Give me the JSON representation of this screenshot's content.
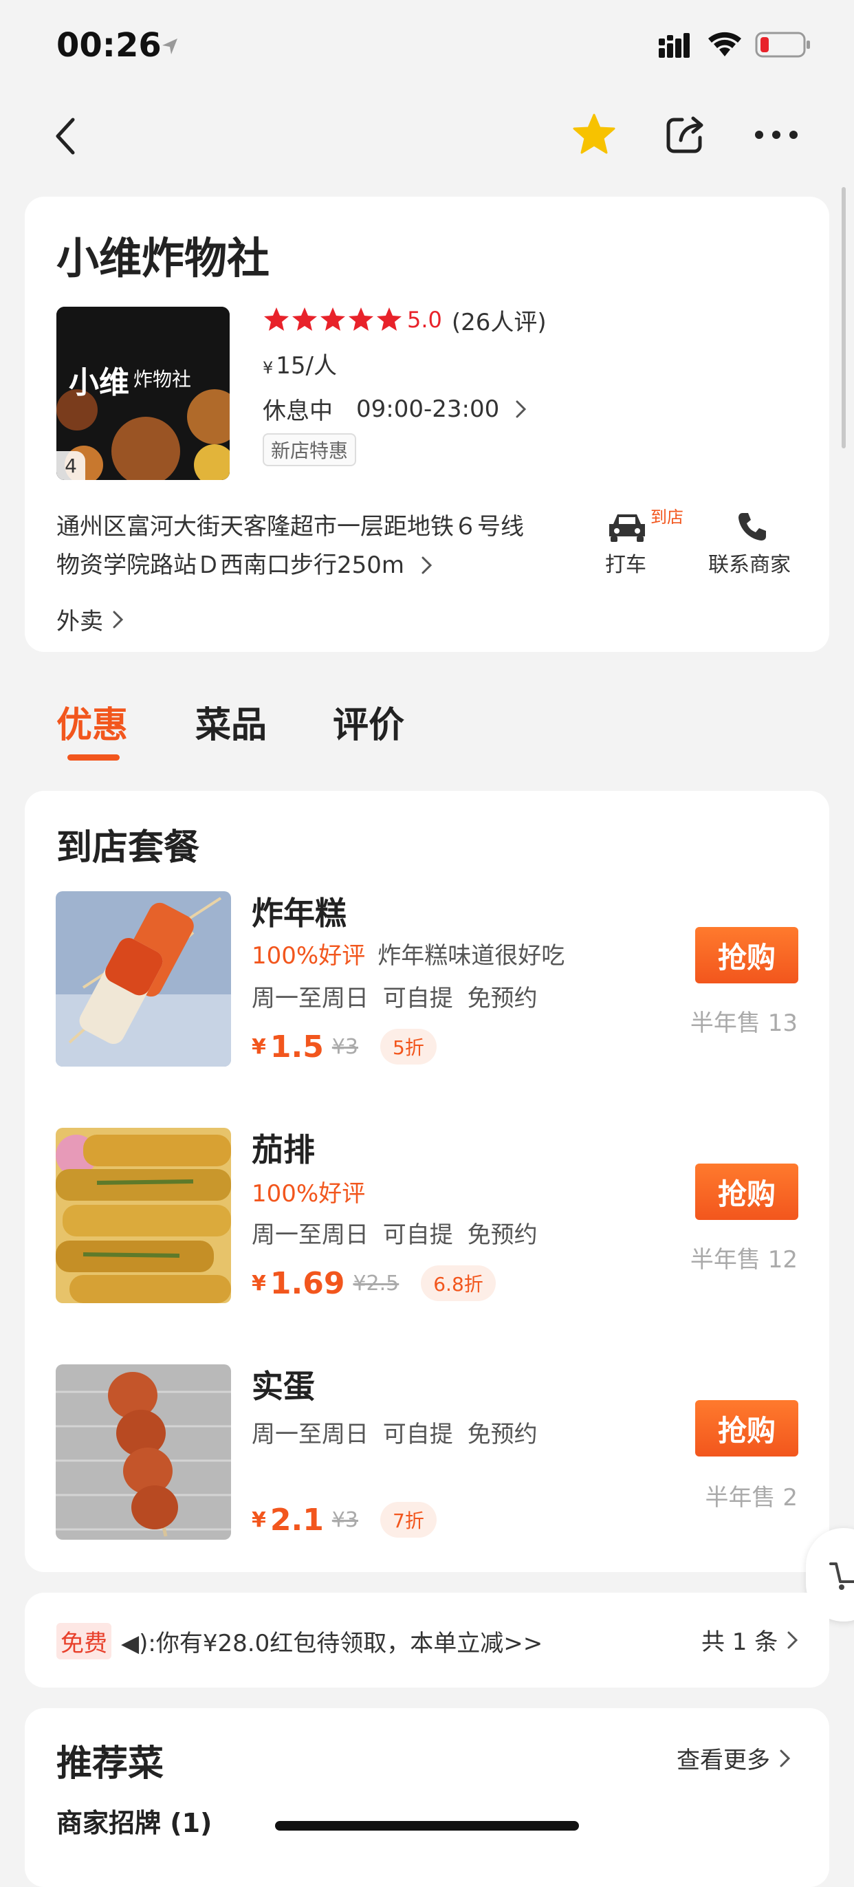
{
  "status_bar": {
    "time": "00:26"
  },
  "nav": {
    "back_icon": "chevron-left-icon",
    "favorite_icon": "star-icon",
    "share_icon": "share-icon",
    "more_icon": "more-icon",
    "favorite_color": "#f7c200"
  },
  "shop": {
    "name": "小维炸物社",
    "photo_count": "4",
    "rating": "5.0",
    "rating_count": "(26人评)",
    "star_count": 5,
    "price_symbol": "¥",
    "price_per_person": "15/人",
    "status": "休息中",
    "hours": "09:00-23:00",
    "tag": "新店特惠",
    "address_line1": "通州区富河大街天客隆超市一层距地铁６号线",
    "address_line2": "物资学院路站Ｄ西南口步行250m",
    "taxi_badge": "到店",
    "taxi_label": "打车",
    "contact_label": "联系商家",
    "delivery_label": "外卖"
  },
  "tabs": [
    {
      "label": "优惠",
      "active": true
    },
    {
      "label": "菜品",
      "active": false
    },
    {
      "label": "评价",
      "active": false
    }
  ],
  "deals_section": {
    "title": "到店套餐",
    "items": [
      {
        "name": "炸年糕",
        "good_rate": "100%好评",
        "review": "炸年糕味道很好吃",
        "tags": "周一至周日  可自提  免预约",
        "price_symbol": "¥",
        "price": "1.5",
        "original": "¥3",
        "discount": "5折",
        "buy_label": "抢购",
        "sold": "半年售 13"
      },
      {
        "name": "茄排",
        "good_rate": "100%好评",
        "review": "",
        "tags": "周一至周日  可自提  免预约",
        "price_symbol": "¥",
        "price": "1.69",
        "original": "¥2.5",
        "discount": "6.8折",
        "buy_label": "抢购",
        "sold": "半年售 12"
      },
      {
        "name": "实蛋",
        "good_rate": "",
        "review": "",
        "tags": "周一至周日  可自提  免预约",
        "price_symbol": "¥",
        "price": "2.1",
        "original": "¥3",
        "discount": "7折",
        "buy_label": "抢购",
        "sold": "半年售 2"
      }
    ]
  },
  "promo": {
    "free_tag": "免费",
    "text": "◀):你有¥28.0红包待领取，本单立减>>",
    "count": "共 1 条"
  },
  "recommend": {
    "title": "推荐菜",
    "more": "查看更多",
    "subtitle": "商家招牌 (1)"
  },
  "colors": {
    "accent": "#f2561d",
    "star": "#e8222a",
    "background": "#f3f3f3"
  }
}
